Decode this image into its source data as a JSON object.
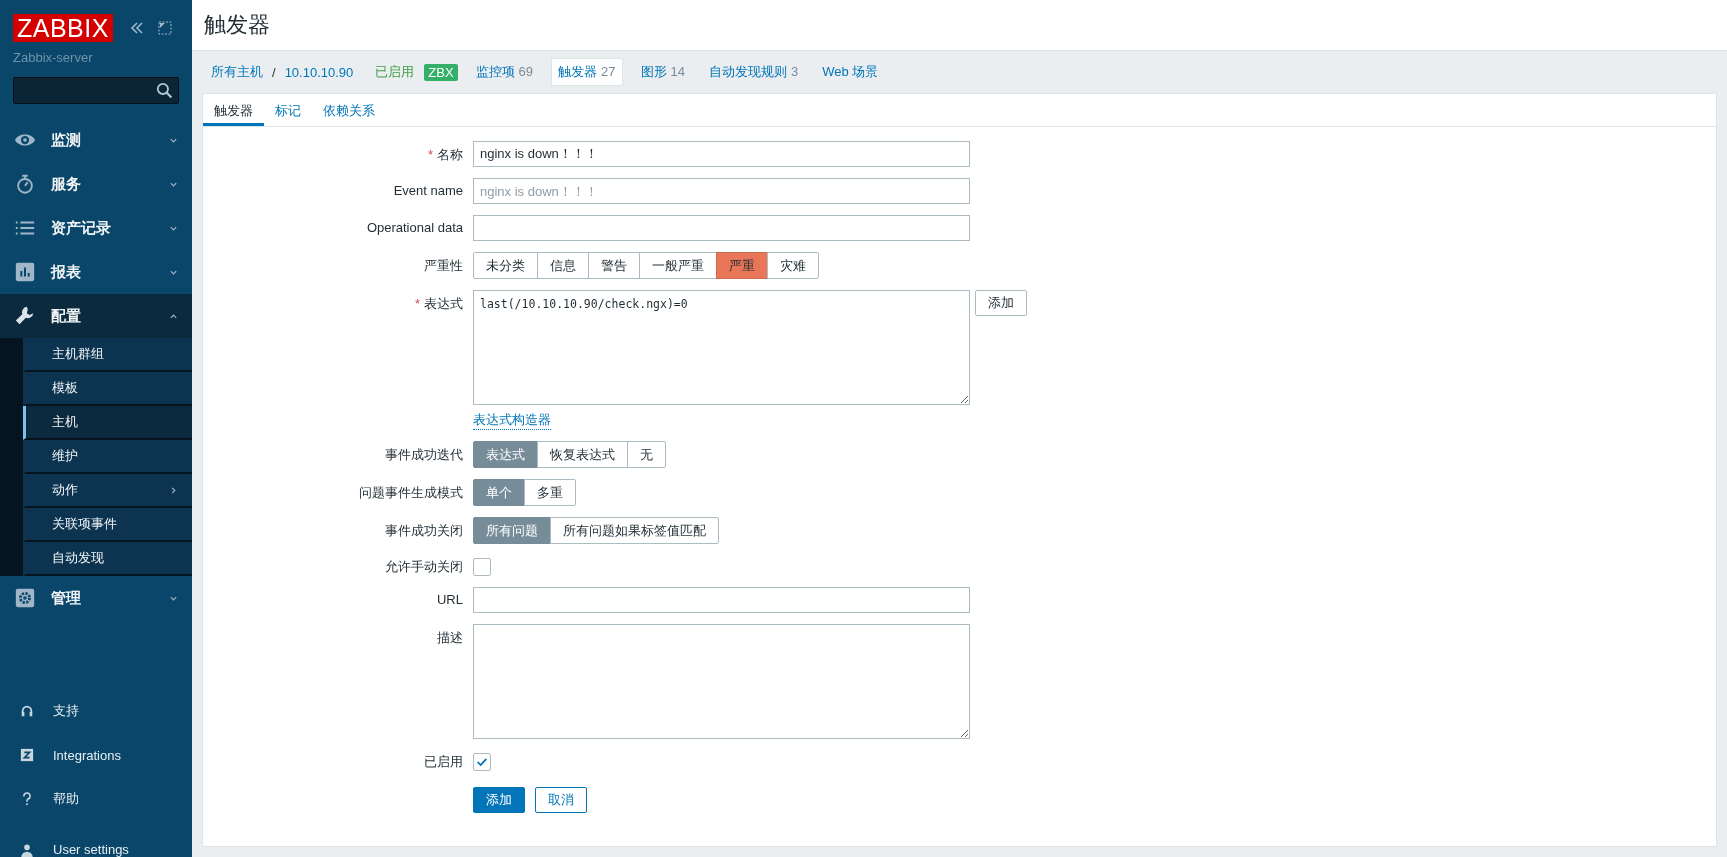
{
  "sidebar": {
    "logo": "ZABBIX",
    "server": "Zabbix-server",
    "menu": [
      {
        "kind": "eye",
        "label": "监测",
        "expanded": false
      },
      {
        "kind": "stopwatch",
        "label": "服务",
        "expanded": false
      },
      {
        "kind": "list",
        "label": "资产记录",
        "expanded": false
      },
      {
        "kind": "chart",
        "label": "报表",
        "expanded": false
      },
      {
        "kind": "wrench",
        "label": "配置",
        "expanded": true,
        "children": [
          {
            "label": "主机群组",
            "selected": false,
            "has_submenu": false
          },
          {
            "label": "模板",
            "selected": false,
            "has_submenu": false
          },
          {
            "label": "主机",
            "selected": true,
            "has_submenu": false
          },
          {
            "label": "维护",
            "selected": false,
            "has_submenu": false
          },
          {
            "label": "动作",
            "selected": false,
            "has_submenu": true
          },
          {
            "label": "关联项事件",
            "selected": false,
            "has_submenu": false
          },
          {
            "label": "自动发现",
            "selected": false,
            "has_submenu": false
          }
        ]
      },
      {
        "kind": "gear",
        "label": "管理",
        "expanded": false
      }
    ],
    "footer": [
      {
        "kind": "headset",
        "label": "支持"
      },
      {
        "kind": "zbox",
        "label": "Integrations"
      },
      {
        "kind": "question",
        "label": "帮助"
      },
      {
        "kind": "user",
        "label": "User settings"
      }
    ]
  },
  "header": {
    "title": "触发器"
  },
  "breadcrumb": {
    "host_group": "所有主机",
    "separator": "/",
    "host": "10.10.10.90",
    "status": "已启用",
    "badge": "ZBX",
    "nav": [
      {
        "label": "监控项",
        "count": "69",
        "selected": false
      },
      {
        "label": "触发器",
        "count": "27",
        "selected": true
      },
      {
        "label": "图形",
        "count": "14",
        "selected": false
      },
      {
        "label": "自动发现规则",
        "count": "3",
        "selected": false
      },
      {
        "label": "Web 场景",
        "selected": false
      }
    ]
  },
  "tabs": [
    {
      "label": "触发器",
      "selected": true
    },
    {
      "label": "标记",
      "selected": false
    },
    {
      "label": "依赖关系",
      "selected": false
    }
  ],
  "form": [
    {
      "kind": "input",
      "label": "名称",
      "required_mark": "*",
      "value": "nginx is down！！！"
    },
    {
      "kind": "input",
      "label": "Event name",
      "placeholder": "nginx is down！！！"
    },
    {
      "kind": "input",
      "label": "Operational data"
    },
    {
      "kind": "severity",
      "label": "严重性",
      "options": [
        {
          "label": "未分类",
          "selected": false
        },
        {
          "label": "信息",
          "selected": false
        },
        {
          "label": "警告",
          "selected": false
        },
        {
          "label": "一般严重",
          "selected": false
        },
        {
          "label": "严重",
          "selected": true
        },
        {
          "label": "灾难",
          "selected": false
        }
      ]
    },
    {
      "kind": "expression",
      "label": "表达式",
      "required_mark": "*",
      "value": "last(/10.10.10.90/check.ngx)=0",
      "button": "添加",
      "link": "表达式构造器"
    },
    {
      "kind": "segmented",
      "label": "事件成功迭代",
      "options": [
        {
          "label": "表达式",
          "selected": true
        },
        {
          "label": "恢复表达式",
          "selected": false
        },
        {
          "label": "无",
          "selected": false
        }
      ]
    },
    {
      "kind": "segmented",
      "label": "问题事件生成模式",
      "options": [
        {
          "label": "单个",
          "selected": true
        },
        {
          "label": "多重",
          "selected": false
        }
      ]
    },
    {
      "kind": "segmented",
      "label": "事件成功关闭",
      "options": [
        {
          "label": "所有问题",
          "selected": true
        },
        {
          "label": "所有问题如果标签值匹配",
          "selected": false
        }
      ]
    },
    {
      "kind": "checkbox",
      "label": "允许手动关闭",
      "checked": false
    },
    {
      "kind": "input",
      "label": "URL"
    },
    {
      "kind": "textarea",
      "label": "描述"
    },
    {
      "kind": "checkbox",
      "label": "已启用",
      "checked": true
    }
  ],
  "buttons": [
    {
      "label": "添加",
      "primary": true
    },
    {
      "label": "取消",
      "primary": false
    }
  ]
}
